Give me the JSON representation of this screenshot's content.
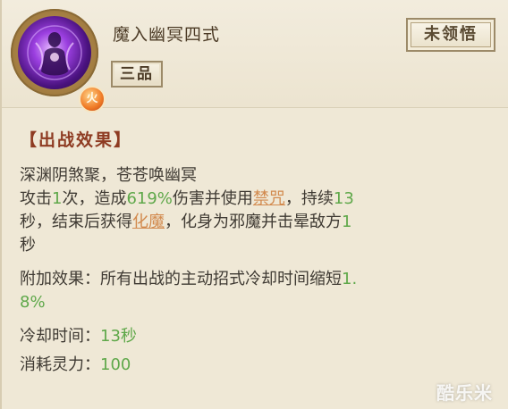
{
  "skill": {
    "name": "魔入幽冥四式",
    "grade": "三品",
    "status": "未领悟",
    "element_badge": "火",
    "icon": "purple-demon-figure-icon"
  },
  "effect": {
    "section_title": "【出战效果】",
    "flavor": "深渊阴煞聚，苍苍唤幽冥",
    "line1": {
      "p1": "攻击",
      "hits": "1",
      "p2": "次，造成",
      "damage": "619%",
      "p3": "伤害并使用",
      "kw1": "禁咒",
      "p4": "，持续",
      "duration_a": "13"
    },
    "line2": {
      "p1": "秒，结束后获得",
      "kw2": "化魔",
      "p2": "，化身为邪魔并击晕敌方",
      "stun": "1"
    },
    "line3": "秒",
    "extra_label": "附加效果：所有出战的主动招式冷却时间缩短",
    "extra_value_a": "1.",
    "extra_value_b": "8%",
    "cooldown_label": "冷却时间：",
    "cooldown_value": "13秒",
    "cost_label": "消耗灵力：",
    "cost_value": "100"
  },
  "watermark": "酷乐米",
  "colors": {
    "number": "#5fa84a",
    "keyword": "#d28a4e",
    "title": "#8e3b22",
    "background": "#efe8d6"
  }
}
